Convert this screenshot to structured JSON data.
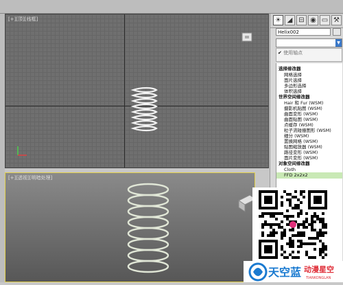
{
  "viewports": {
    "top": {
      "label": "[+][顶][线框]"
    },
    "perspective": {
      "label": "[+][透视][明暗处理]"
    }
  },
  "panel": {
    "tabs": [
      {
        "icon": "sun-icon",
        "glyph": "☀"
      },
      {
        "icon": "modify-icon",
        "glyph": "◢"
      },
      {
        "icon": "hierarchy-icon",
        "glyph": "⊟"
      },
      {
        "icon": "motion-icon",
        "glyph": "◉"
      },
      {
        "icon": "display-icon",
        "glyph": "▭"
      },
      {
        "icon": "utilities-icon",
        "glyph": "⚒"
      }
    ],
    "object_name": "Helix002",
    "modifier_dropdown": "",
    "stack_check": "✔",
    "stack_item": "使用轴点",
    "groups": [
      {
        "heading": "选择修改器",
        "items": [
          "网格选择",
          "面片选择",
          "多边形选择",
          "体积选择"
        ]
      },
      {
        "heading": "世界空间修改器",
        "items": [
          "Hair 和 Fur (WSM)",
          "摄影机贴图 (WSM)",
          "曲面变形 (WSM)",
          "曲面贴图 (WSM)",
          "点缓存 (WSM)",
          "粒子流碰撞图形 (WSM)",
          "细分 (WSM)",
          "置换网格 (WSM)",
          "贴图缩放器 (WSM)",
          "路径变形 (WSM)",
          "面片变形 (WSM)"
        ]
      },
      {
        "heading": "对象空间修改器",
        "items": [
          "Cloth",
          "FFD 2x2x2"
        ]
      }
    ]
  },
  "watermark": {
    "logo_text": "天空蓝",
    "brand_text": "动漫星空",
    "brand_sub": "TIANKONGLAN"
  },
  "colors": {
    "active_viewport_border": "#e3d14a",
    "selected_item": "#c9e9b5",
    "helix": "#f2f2f2",
    "logo_blue": "#1a7ad0",
    "logo_red": "#e0303a"
  }
}
